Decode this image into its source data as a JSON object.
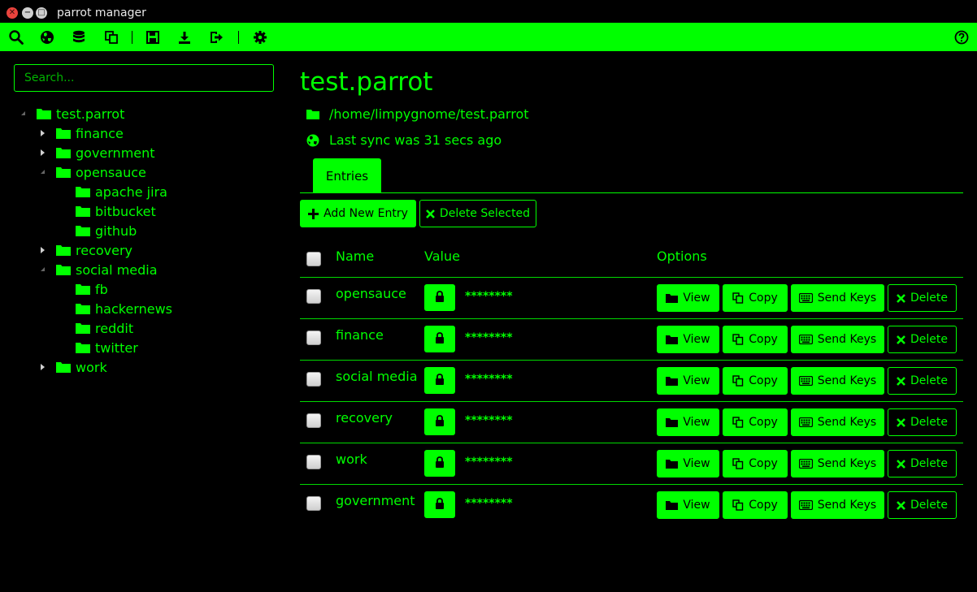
{
  "window": {
    "title": "parrot manager"
  },
  "toolbar": {
    "icons": [
      "search-icon",
      "globe-icon",
      "database-icon",
      "copy-icon",
      "save-icon",
      "download-icon",
      "exit-icon",
      "gear-icon",
      "help-icon"
    ]
  },
  "sidebar": {
    "search_placeholder": "Search...",
    "tree": [
      {
        "label": "test.parrot",
        "level": 0,
        "state": "open"
      },
      {
        "label": "finance",
        "level": 1,
        "state": "closed"
      },
      {
        "label": "government",
        "level": 1,
        "state": "closed"
      },
      {
        "label": "opensauce",
        "level": 1,
        "state": "open"
      },
      {
        "label": "apache jira",
        "level": 2,
        "state": "leaf"
      },
      {
        "label": "bitbucket",
        "level": 2,
        "state": "leaf"
      },
      {
        "label": "github",
        "level": 2,
        "state": "leaf"
      },
      {
        "label": "recovery",
        "level": 1,
        "state": "closed"
      },
      {
        "label": "social media",
        "level": 1,
        "state": "open"
      },
      {
        "label": "fb",
        "level": 2,
        "state": "leaf"
      },
      {
        "label": "hackernews",
        "level": 2,
        "state": "leaf"
      },
      {
        "label": "reddit",
        "level": 2,
        "state": "leaf"
      },
      {
        "label": "twitter",
        "level": 2,
        "state": "leaf"
      },
      {
        "label": "work",
        "level": 1,
        "state": "closed"
      }
    ]
  },
  "main": {
    "title": "test.parrot",
    "path": "/home/limpygnome/test.parrot",
    "sync_status": "Last sync was 31 secs ago",
    "tab": "Entries",
    "add_button": "Add New Entry",
    "delete_selected_button": "Delete Selected",
    "columns": {
      "name": "Name",
      "value": "Value",
      "options": "Options"
    },
    "actions": {
      "view": "View",
      "copy": "Copy",
      "send_keys": "Send Keys",
      "delete": "Delete"
    },
    "entries": [
      {
        "name": "opensauce",
        "value": "********"
      },
      {
        "name": "finance",
        "value": "********"
      },
      {
        "name": "social media",
        "value": "********"
      },
      {
        "name": "recovery",
        "value": "********"
      },
      {
        "name": "work",
        "value": "********"
      },
      {
        "name": "government",
        "value": "********"
      }
    ]
  },
  "colors": {
    "accent": "#00ff00",
    "background": "#000000",
    "close": "#e8433d"
  }
}
